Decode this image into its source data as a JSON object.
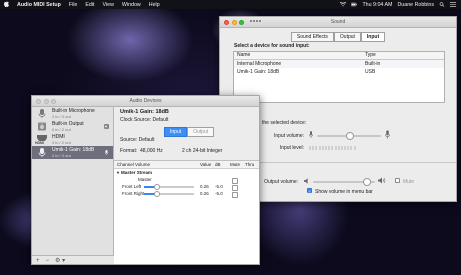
{
  "menubar": {
    "app": "Audio MIDI Setup",
    "items": [
      "File",
      "Edit",
      "View",
      "Window",
      "Help"
    ],
    "clock": "Thu 9:04 AM",
    "user": "Duane Robbins"
  },
  "sound_window": {
    "title": "Sound",
    "tabs": [
      "Sound Effects",
      "Output",
      "Input"
    ],
    "selected_tab": "Input",
    "select_label": "Select a device for sound input:",
    "columns": [
      "Name",
      "Type"
    ],
    "devices": [
      {
        "name": "Internal Microphone",
        "type": "Built-in"
      },
      {
        "name": "Umik-1  Gain: 18dB",
        "type": "USB"
      }
    ],
    "selected_device_label": "the selected device:",
    "input_volume_label": "Input volume:",
    "input_level_label": "Input level:",
    "output_volume_label": "Output volume:",
    "mute_label": "Mute",
    "show_volume_label": "Show volume in menu bar",
    "input_volume_fraction": 0.5,
    "output_volume_fraction": 0.85
  },
  "audio_window": {
    "title": "Audio Devices",
    "devices": [
      {
        "name": "Built-in Microphone",
        "sub": "2 in / 0 out"
      },
      {
        "name": "Built-in Output",
        "sub": "0 in / 2 out"
      },
      {
        "name": "HDMI",
        "sub": "0 in / 2 out"
      },
      {
        "name": "Umik-1  Gain: 18dB",
        "sub": "2 in / 0 out"
      }
    ],
    "hdmi_badge": "HDMI",
    "selected_index": 3,
    "bottom_buttons": [
      "+",
      "−",
      "⚙ ▾"
    ],
    "detail": {
      "name": "Umik-1  Gain: 18dB",
      "clock_source": "Clock Source:  Default",
      "io_tabs": [
        "Input",
        "Output"
      ],
      "source": "Source:  Default",
      "format_label": "Format:",
      "format_rate": "48,000 Hz",
      "format_bits": "2 ch 24-bit Integer"
    },
    "channel_table": {
      "headers": [
        "Channel Volume",
        "Value",
        "dB",
        "Mute",
        "Thru"
      ],
      "group": "Master Stream",
      "rows": [
        {
          "name": "Master",
          "value": "",
          "db": ""
        },
        {
          "name": "Front Left",
          "value": "0.26",
          "db": "-5.0"
        },
        {
          "name": "Front Right",
          "value": "0.26",
          "db": "-5.0"
        }
      ]
    }
  }
}
